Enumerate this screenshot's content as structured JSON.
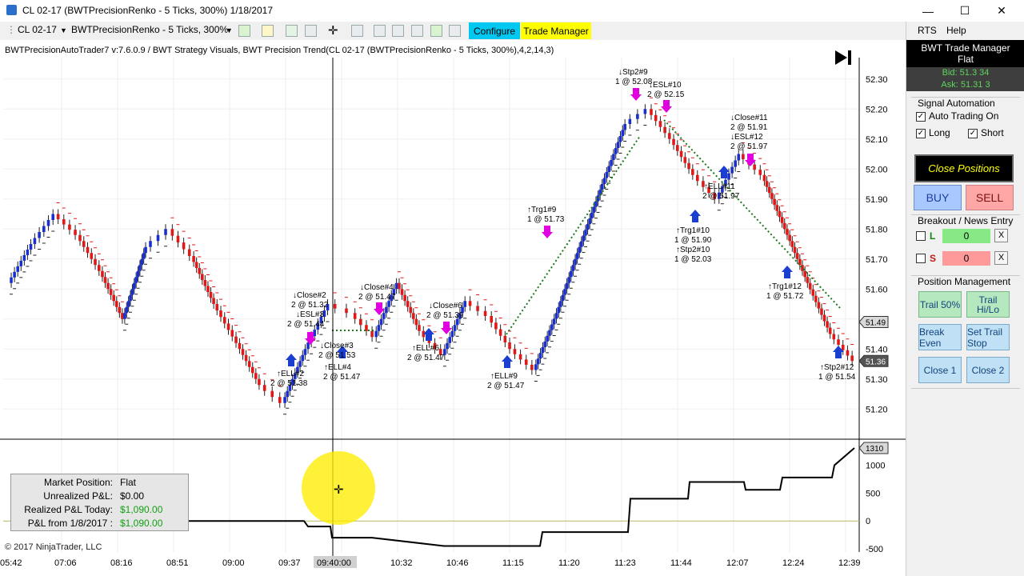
{
  "window": {
    "title": "CL 02-17 (BWTPrecisionRenko - 5 Ticks, 300%)  1/18/2017",
    "minimize_glyph": "—",
    "maximize_glyph": "☐",
    "close_glyph": "✕"
  },
  "toolbar": {
    "instrument": "CL 02-17",
    "bar_type": "BWTPrecisionRenko - 5 Ticks, 300%",
    "configure_label": "Configure",
    "trade_manager_label": "Trade Manager"
  },
  "chart": {
    "strategy_label": "BWTPrecisionAutoTrader7 v:7.6.0.9 / BWT Strategy Visuals, BWT Precision Trend(CL 02-17 (BWTPrecisionRenko - 5 Ticks, 300%),4,2,14,3)",
    "copyright": "© 2017 NinjaTrader, LLC",
    "price_ticks": [
      "52.30",
      "52.20",
      "52.10",
      "52.00",
      "51.90",
      "51.80",
      "51.70",
      "51.60",
      "51.50",
      "51.40",
      "51.30",
      "51.20"
    ],
    "current_price_flag_1": "51.49",
    "current_price_flag_2": "51.36",
    "pnl_ticks": [
      "1000",
      "500",
      "0",
      "-500"
    ],
    "pnl_flag": "1310",
    "time_ticks": [
      "05:42",
      "07:06",
      "08:16",
      "08:51",
      "09:00",
      "09:37",
      "09:40:00",
      "10:32",
      "10:46",
      "11:15",
      "11:20",
      "11:23",
      "11:44",
      "12:07",
      "12:24",
      "12:39"
    ],
    "cursor_time": "09:40:00"
  },
  "chart_data": {
    "type": "line",
    "title": "",
    "xlabel": "",
    "ylabel": "",
    "ylim": [
      51.15,
      52.35
    ],
    "pnl_ylim": [
      -500,
      1310
    ],
    "series": [
      {
        "name": "",
        "y": [
          51.62,
          51.75,
          51.85,
          51.78,
          51.66,
          51.5,
          51.74,
          51.8,
          51.71,
          51.55,
          51.42,
          51.28,
          51.22,
          51.4,
          51.55,
          51.52,
          51.44,
          51.62,
          51.46,
          51.38,
          51.56,
          51.51,
          51.4,
          51.33,
          51.52,
          51.74,
          51.95,
          52.15,
          52.2,
          52.1,
          51.98,
          51.9,
          52.05,
          51.98,
          51.8,
          51.62,
          51.45,
          51.36
        ]
      }
    ],
    "pnl_series": [
      0,
      0,
      0,
      0,
      0,
      -100,
      -100,
      -300,
      -300,
      -450,
      -450,
      -450,
      -200,
      -200,
      400,
      400,
      700,
      700,
      560,
      560,
      780,
      780,
      1000,
      1310
    ]
  },
  "annotations": [
    {
      "text": "↓Stp2#9"
    },
    {
      "text": "1 @ 52.08"
    },
    {
      "text": "↓ESL#10"
    },
    {
      "text": "2 @ 52.15"
    },
    {
      "text": "↓Close#11"
    },
    {
      "text": "2 @ 51.91"
    },
    {
      "text": "↓ESL#12"
    },
    {
      "text": "2 @ 51.97"
    },
    {
      "text": "↑ELL#11"
    },
    {
      "text": "2 @ 51.97"
    },
    {
      "text": "↑Trg1#10"
    },
    {
      "text": "1 @ 51.90"
    },
    {
      "text": "↑Stp2#10"
    },
    {
      "text": "1 @ 52.03"
    },
    {
      "text": "↑Trg1#9"
    },
    {
      "text": "1 @ 51.73"
    },
    {
      "text": "↑Trg1#12"
    },
    {
      "text": "1 @ 51.72"
    },
    {
      "text": "↑Stp2#12"
    },
    {
      "text": "1 @ 51.54"
    },
    {
      "text": "↓Close#2"
    },
    {
      "text": "2 @ 51.32"
    },
    {
      "text": "↓ESL#3"
    },
    {
      "text": "2 @ 51.44"
    },
    {
      "text": "↑ELL#2"
    },
    {
      "text": "2 @ 51.38"
    },
    {
      "text": "↓Close#3"
    },
    {
      "text": "2 @ 51.53"
    },
    {
      "text": "↑ELL#4"
    },
    {
      "text": "2 @ 51.47"
    },
    {
      "text": "↓Close#4"
    },
    {
      "text": "2 @ 51.47"
    },
    {
      "text": "↓Close#6"
    },
    {
      "text": "2 @ 51.39"
    },
    {
      "text": "↑ELL#6"
    },
    {
      "text": "2 @ 51.47"
    },
    {
      "text": "↑ELL#9"
    },
    {
      "text": "2 @ 51.47"
    }
  ],
  "position_summary": {
    "market_position_label": "Market Position:",
    "market_position": "Flat",
    "unrealized_label": "Unrealized P&L:",
    "unrealized": "$0.00",
    "realized_label": "Realized P&L Today:",
    "realized": "$1,090.00",
    "since_label": "P&L from 1/8/2017 :",
    "since": "$1,090.00"
  },
  "panel": {
    "menu_rts": "RTS",
    "menu_help": "Help",
    "header_title": "BWT Trade Manager",
    "header_status": "Flat",
    "bid": "Bid: 51.3 34",
    "ask": "Ask: 51.31 3",
    "signal_title": "Signal Automation",
    "auto_trading": "Auto Trading On",
    "long": "Long",
    "short": "Short",
    "close_positions": "Close Positions",
    "buy": "BUY",
    "sell": "SELL",
    "breakout_title": "Breakout / News Entry",
    "l_label": "L",
    "s_label": "S",
    "l_value": "0",
    "s_value": "0",
    "x_glyph": "X",
    "position_mgmt_title": "Position Management",
    "trail50": "Trail 50%",
    "trail_hilo": "Trail Hi/Lo",
    "break_even": "Break Even",
    "set_trail_stop": "Set Trail Stop",
    "close1": "Close 1",
    "close2": "Close 2",
    "colors": {
      "l_input": "#86e986",
      "s_input": "#ff9a9a",
      "up_bar": "#1a2fd0",
      "down_bar": "#e01818"
    }
  }
}
